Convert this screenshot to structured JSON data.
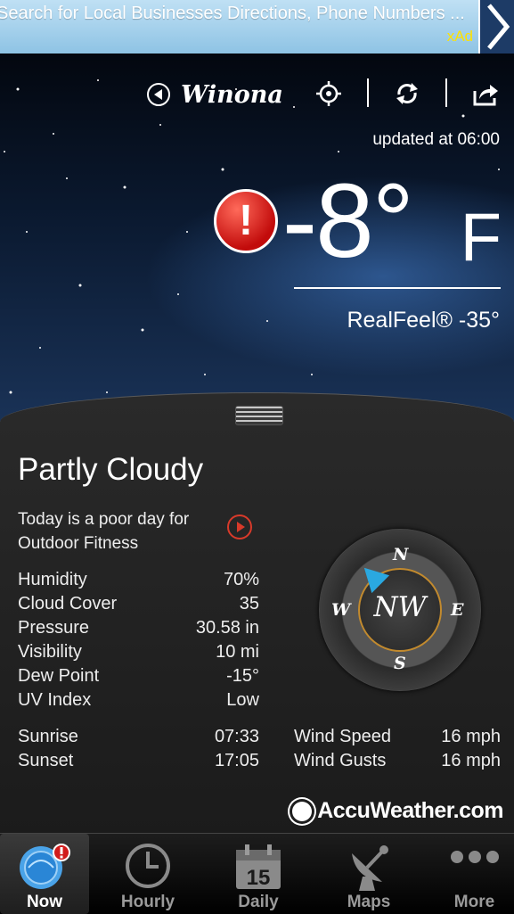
{
  "ad": {
    "text": "Search for Local Businesses Directions, Phone Numbers ...",
    "brand": "xAd"
  },
  "header": {
    "location": "Winona",
    "updated": "updated at 06:00"
  },
  "current": {
    "temperature": "-8°",
    "unit": "F",
    "realfeel": "RealFeel® -35°",
    "condition": "Partly Cloudy",
    "fitness_line1": "Today is a poor day for",
    "fitness_line2": "Outdoor Fitness"
  },
  "stats": [
    {
      "label": "Humidity",
      "value": "70%"
    },
    {
      "label": "Cloud Cover",
      "value": "35"
    },
    {
      "label": "Pressure",
      "value": "30.58 in"
    },
    {
      "label": "Visibility",
      "value": "10 mi"
    },
    {
      "label": "Dew Point",
      "value": "-15°"
    },
    {
      "label": "UV Index",
      "value": "Low"
    }
  ],
  "sun": [
    {
      "label": "Sunrise",
      "value": "07:33"
    },
    {
      "label": "Sunset",
      "value": "17:05"
    }
  ],
  "wind": [
    {
      "label": "Wind Speed",
      "value": "16 mph"
    },
    {
      "label": "Wind Gusts",
      "value": "16 mph"
    }
  ],
  "compass": {
    "N": "N",
    "S": "S",
    "E": "E",
    "W": "W",
    "direction": "NW"
  },
  "brand": "AccuWeather.com",
  "tabs": [
    {
      "label": "Now",
      "icon": "now-globe-icon",
      "active": true
    },
    {
      "label": "Hourly",
      "icon": "clock-icon",
      "active": false
    },
    {
      "label": "Daily",
      "icon": "calendar-icon",
      "active": false,
      "icon_text": "15"
    },
    {
      "label": "Maps",
      "icon": "satellite-dish-icon",
      "active": false
    },
    {
      "label": "More",
      "icon": "more-dots-icon",
      "active": false
    }
  ],
  "colors": {
    "alert": "#c20b0b",
    "accent_blue": "#2aa8e0",
    "compass_ring": "#c28a2e",
    "play": "#d83a2a"
  }
}
